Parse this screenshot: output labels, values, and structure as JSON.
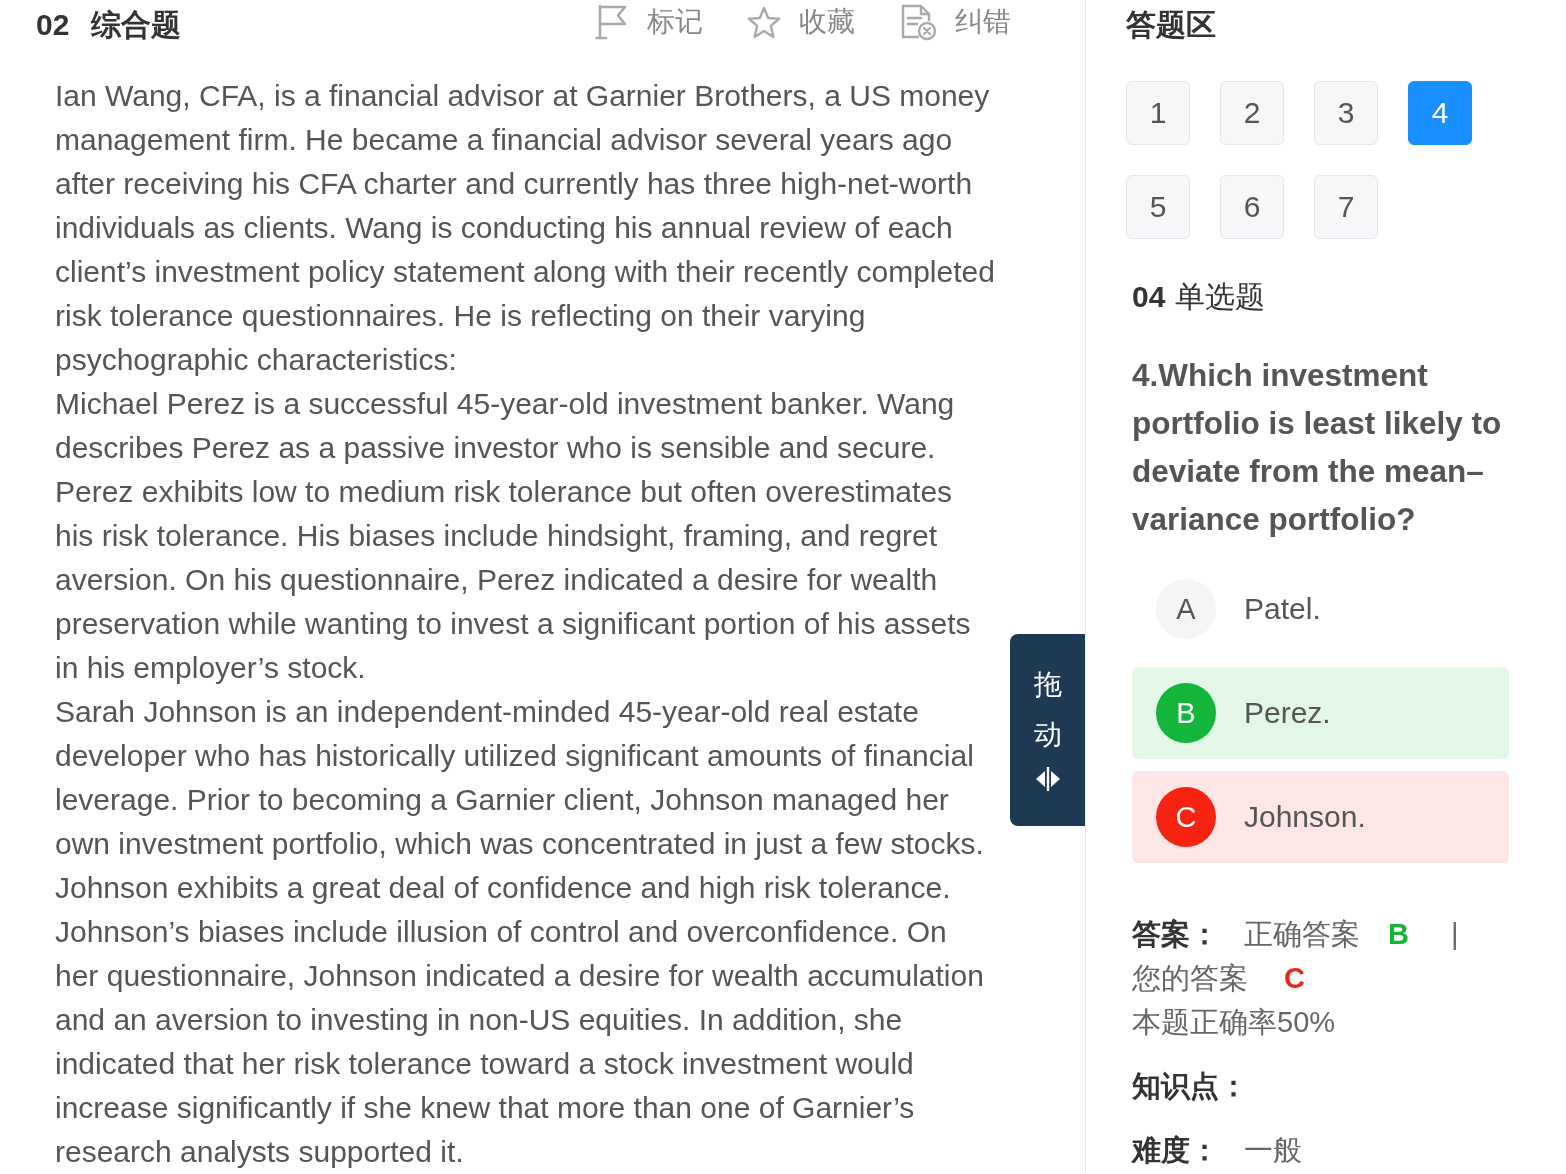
{
  "question_header": {
    "number": "02",
    "type": "综合题"
  },
  "toolbar": [
    {
      "kind": "flag",
      "label": "标记"
    },
    {
      "kind": "star",
      "label": "收藏"
    },
    {
      "kind": "report",
      "label": "纠错"
    }
  ],
  "passage": [
    "Ian Wang, CFA, is a financial advisor at Garnier Brothers, a US money management firm. He became a financial advisor several years ago after receiving his CFA charter and currently has three high-net-worth individuals as clients. Wang is conducting his annual review of each client’s investment policy statement along with their recently completed risk tolerance questionnaires. He is reflecting on their varying psychographic characteristics:",
    "Michael Perez is a successful 45-year-old investment banker. Wang describes Perez as a passive investor who is sensible and secure. Perez exhibits low to medium risk tolerance but often overestimates his risk tolerance. His biases include hindsight, framing, and regret aversion. On his questionnaire, Perez indicated a desire for wealth preservation while wanting to invest a significant portion of his assets in his employer’s stock.",
    "Sarah Johnson is an independent-minded 45-year-old real estate developer who has historically utilized significant amounts of financial leverage. Prior to becoming a Garnier client, Johnson managed her own investment portfolio, which was concentrated in just a few stocks. Johnson exhibits a great deal of confidence and high risk tolerance. Johnson’s biases include illusion of control and overconfidence. On her questionnaire, Johnson indicated a desire for wealth accumulation and an aversion to investing in non-US equities. In addition, she indicated that her risk tolerance toward a stock investment would increase significantly if she knew that more than one of Garnier’s research analysts supported it."
  ],
  "drag_handle": {
    "label": "拖动"
  },
  "answer_area": {
    "title": "答题区",
    "question_numbers": [
      {
        "label": "1",
        "selected": false
      },
      {
        "label": "2",
        "selected": false
      },
      {
        "label": "3",
        "selected": false
      },
      {
        "label": "4",
        "selected": true
      },
      {
        "label": "5",
        "selected": false
      },
      {
        "label": "6",
        "selected": false
      },
      {
        "label": "7",
        "selected": false
      }
    ]
  },
  "question": {
    "number": "04",
    "type": "单选题",
    "text": "4.Which investment portfolio is least likely to deviate from the mean–variance portfolio?",
    "options": [
      {
        "letter": "A",
        "text": "Patel.",
        "selected": false,
        "correct": false
      },
      {
        "letter": "B",
        "text": "Perez.",
        "selected": false,
        "correct": true
      },
      {
        "letter": "C",
        "text": "Johnson.",
        "selected": true,
        "correct": false
      }
    ]
  },
  "answer": {
    "label": "答案：",
    "correct_label": "正确答案",
    "correct_value": "B",
    "separator": "|",
    "your_label": "您的答案",
    "your_value": "C",
    "accuracy": "本题正确率50%"
  },
  "knowledge_point": {
    "label": "知识点："
  },
  "difficulty": {
    "label": "难度：",
    "value": "一般"
  }
}
